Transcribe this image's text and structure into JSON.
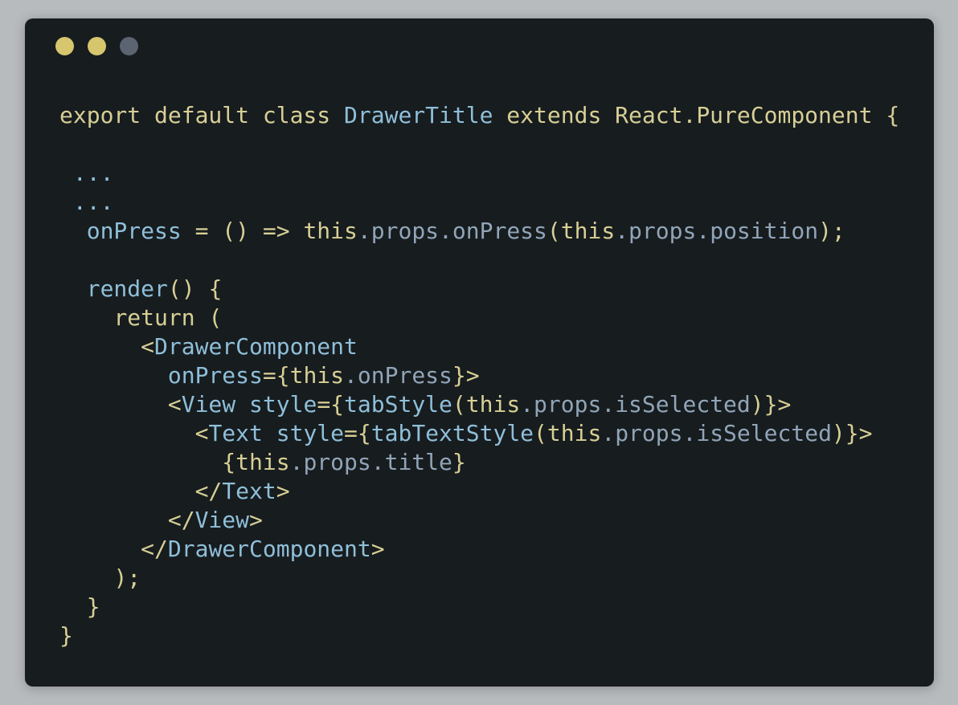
{
  "colors": {
    "background": "#b8bbbe",
    "window": "#171c1f",
    "close_dot": "#d6c66e",
    "minimize_dot": "#d6c66e",
    "maximize_dot": "#5b6470",
    "keyword": "#d7cf95",
    "identifier": "#8fbfd9",
    "property": "#91a5b8",
    "punctuation": "#d7cf95",
    "dim": "#8ea2b4"
  },
  "window_controls": [
    {
      "name": "close",
      "color": "#d6c66e"
    },
    {
      "name": "minimize",
      "color": "#d6c66e"
    },
    {
      "name": "maximize",
      "color": "#5b6470"
    }
  ],
  "code_lines": [
    {
      "indent": "",
      "tokens": [
        {
          "t": "export default class ",
          "c": "keyword"
        },
        {
          "t": "DrawerTitle",
          "c": "identifier"
        },
        {
          "t": " extends React.PureComponent {",
          "c": "keyword"
        }
      ]
    },
    {
      "indent": "",
      "tokens": []
    },
    {
      "indent": " ",
      "tokens": [
        {
          "t": "...",
          "c": "identifier"
        }
      ]
    },
    {
      "indent": " ",
      "tokens": [
        {
          "t": "...",
          "c": "identifier"
        }
      ]
    },
    {
      "indent": "  ",
      "tokens": [
        {
          "t": "onPress",
          "c": "identifier"
        },
        {
          "t": " = () => ",
          "c": "keyword"
        },
        {
          "t": "this",
          "c": "keyword"
        },
        {
          "t": ".props.onPress",
          "c": "property"
        },
        {
          "t": "(",
          "c": "keyword"
        },
        {
          "t": "this",
          "c": "keyword"
        },
        {
          "t": ".props.position",
          "c": "property"
        },
        {
          "t": ");",
          "c": "keyword"
        }
      ]
    },
    {
      "indent": "",
      "tokens": []
    },
    {
      "indent": "  ",
      "tokens": [
        {
          "t": "render",
          "c": "identifier"
        },
        {
          "t": "() {",
          "c": "keyword"
        }
      ]
    },
    {
      "indent": "    ",
      "tokens": [
        {
          "t": "return (",
          "c": "keyword"
        }
      ]
    },
    {
      "indent": "      ",
      "tokens": [
        {
          "t": "<",
          "c": "keyword"
        },
        {
          "t": "DrawerComponent",
          "c": "identifier"
        }
      ]
    },
    {
      "indent": "        ",
      "tokens": [
        {
          "t": "onPress",
          "c": "identifier"
        },
        {
          "t": "={",
          "c": "keyword"
        },
        {
          "t": "this",
          "c": "keyword"
        },
        {
          "t": ".onPress",
          "c": "property"
        },
        {
          "t": "}>",
          "c": "keyword"
        }
      ]
    },
    {
      "indent": "        ",
      "tokens": [
        {
          "t": "<",
          "c": "keyword"
        },
        {
          "t": "View",
          "c": "identifier"
        },
        {
          "t": " ",
          "c": "keyword"
        },
        {
          "t": "style",
          "c": "identifier"
        },
        {
          "t": "={",
          "c": "keyword"
        },
        {
          "t": "tabStyle",
          "c": "identifier"
        },
        {
          "t": "(",
          "c": "keyword"
        },
        {
          "t": "this",
          "c": "keyword"
        },
        {
          "t": ".props.isSelected",
          "c": "property"
        },
        {
          "t": ")}>",
          "c": "keyword"
        }
      ]
    },
    {
      "indent": "          ",
      "tokens": [
        {
          "t": "<",
          "c": "keyword"
        },
        {
          "t": "Text",
          "c": "identifier"
        },
        {
          "t": " ",
          "c": "keyword"
        },
        {
          "t": "style",
          "c": "identifier"
        },
        {
          "t": "={",
          "c": "keyword"
        },
        {
          "t": "tabTextStyle",
          "c": "identifier"
        },
        {
          "t": "(",
          "c": "keyword"
        },
        {
          "t": "this",
          "c": "keyword"
        },
        {
          "t": ".props.isSelected",
          "c": "property"
        },
        {
          "t": ")}>",
          "c": "keyword"
        }
      ]
    },
    {
      "indent": "            ",
      "tokens": [
        {
          "t": "{",
          "c": "keyword"
        },
        {
          "t": "this",
          "c": "keyword"
        },
        {
          "t": ".props.title",
          "c": "property"
        },
        {
          "t": "}",
          "c": "keyword"
        }
      ]
    },
    {
      "indent": "          ",
      "tokens": [
        {
          "t": "</",
          "c": "keyword"
        },
        {
          "t": "Text",
          "c": "identifier"
        },
        {
          "t": ">",
          "c": "keyword"
        }
      ]
    },
    {
      "indent": "        ",
      "tokens": [
        {
          "t": "</",
          "c": "keyword"
        },
        {
          "t": "View",
          "c": "identifier"
        },
        {
          "t": ">",
          "c": "keyword"
        }
      ]
    },
    {
      "indent": "      ",
      "tokens": [
        {
          "t": "</",
          "c": "keyword"
        },
        {
          "t": "DrawerComponent",
          "c": "identifier"
        },
        {
          "t": ">",
          "c": "keyword"
        }
      ]
    },
    {
      "indent": "    ",
      "tokens": [
        {
          "t": ");",
          "c": "keyword"
        }
      ]
    },
    {
      "indent": "  ",
      "tokens": [
        {
          "t": "}",
          "c": "keyword"
        }
      ]
    },
    {
      "indent": "",
      "tokens": [
        {
          "t": "}",
          "c": "keyword"
        }
      ]
    }
  ]
}
